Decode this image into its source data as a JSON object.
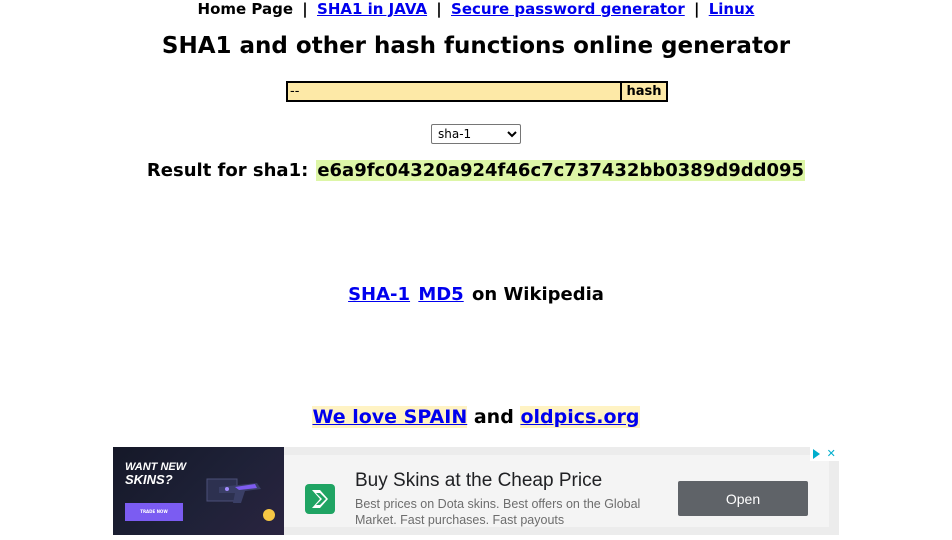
{
  "nav": {
    "home": "Home Page",
    "sha1_java": "SHA1 in JAVA",
    "pwd_gen": "Secure password generator",
    "linux": "Linux",
    "separator": "|"
  },
  "page_title": "SHA1 and other hash functions online generator",
  "form": {
    "input_value": "--",
    "hash_button": "hash",
    "algorithm_selected": "sha-1"
  },
  "result": {
    "label": "Result for sha1:",
    "value": "e6a9fc04320a924f46c7c737432bb0389d9dd095"
  },
  "wiki": {
    "sha1": "SHA-1",
    "md5": "MD5",
    "suffix": "on Wikipedia"
  },
  "love": {
    "spain": "We love SPAIN",
    "and": "and",
    "oldpics": "oldpics.org"
  },
  "ad": {
    "banner_line1": "WANT NEW",
    "banner_line2": "SKINS?",
    "banner_cta": "TRADE NOW",
    "headline": "Buy Skins at the Cheap Price",
    "description": "Best prices on Dota skins. Best offers on the Global Market. Fast purchases. Fast payouts",
    "open_button": "Open",
    "choices_close": "✕"
  },
  "colors": {
    "link": "#0000ee",
    "input_bg": "#fde9a7",
    "result_bg": "#ddf6a7",
    "ad_button": "#5f6368",
    "adchoices": "#00aecd"
  }
}
